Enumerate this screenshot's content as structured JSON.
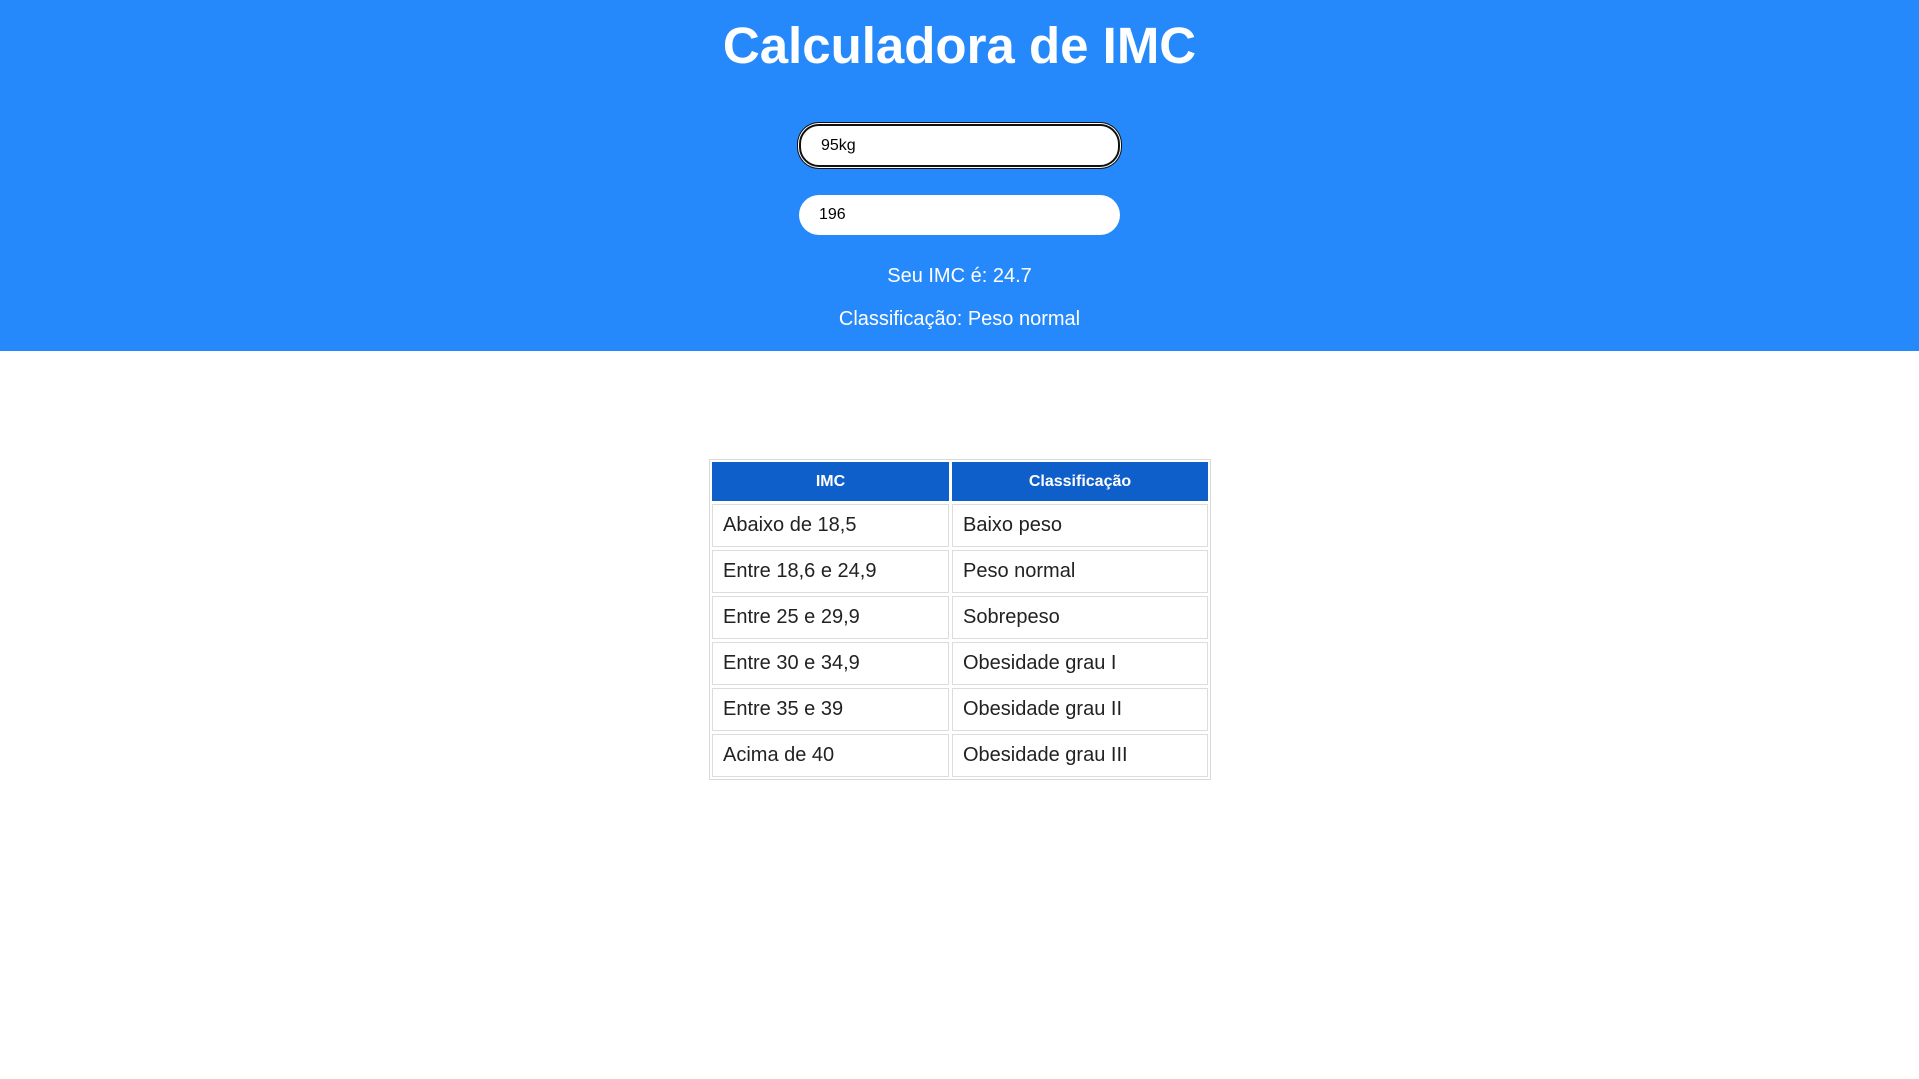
{
  "header": {
    "title": "Calculadora de IMC",
    "weight_value": "95kg",
    "height_value": "196",
    "imc_result": "Seu IMC é: 24.7",
    "classification_result": "Classificação: Peso normal"
  },
  "table": {
    "headers": [
      "IMC",
      "Classificação"
    ],
    "rows": [
      [
        "Abaixo de 18,5",
        "Baixo peso"
      ],
      [
        "Entre 18,6 e 24,9",
        "Peso normal"
      ],
      [
        "Entre 25 e 29,9",
        "Sobrepeso"
      ],
      [
        "Entre 30 e 34,9",
        "Obesidade grau I"
      ],
      [
        "Entre 35 e 39",
        "Obesidade grau II"
      ],
      [
        "Acima de 40",
        "Obesidade grau III"
      ]
    ]
  },
  "colors": {
    "header_bg": "#2689fb",
    "table_header_bg": "#0f5fcb"
  }
}
